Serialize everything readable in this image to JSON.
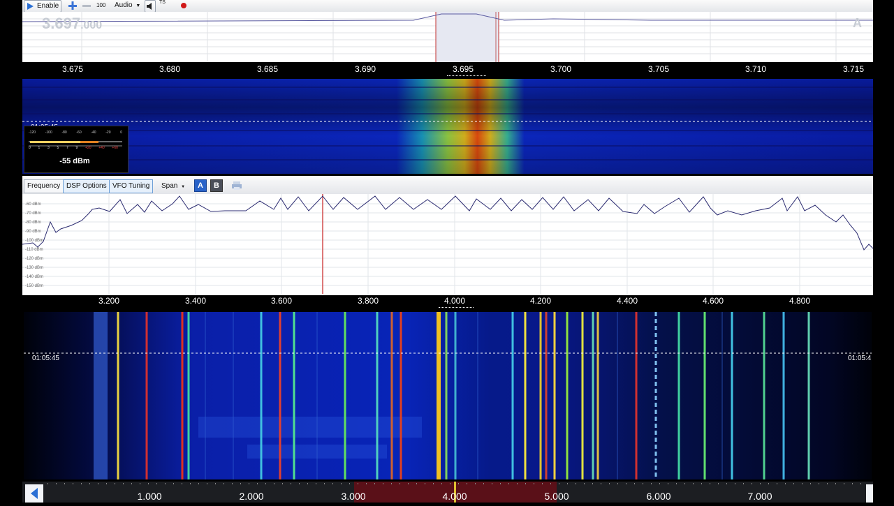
{
  "toolbar": {
    "enable_label": "Enable",
    "zoom_value": "100",
    "audio_label": "Audio",
    "ts_label": "TS"
  },
  "zoom_panel": {
    "frequency_readout": "3.697",
    "frequency_readout_suffix": ".000",
    "vfo_letter": "A",
    "scale_ticks": [
      "3.675",
      "3.680",
      "3.685",
      "3.690",
      "3.695",
      "3.700",
      "3.705",
      "3.710",
      "3.715"
    ],
    "waterfall_time": "01:05:45"
  },
  "smeter": {
    "top_scale": [
      "-120",
      "-100",
      "-80",
      "-60",
      "-40",
      "-20",
      "0"
    ],
    "bottom_scale": [
      "0",
      "1",
      "3",
      "5",
      "7",
      "9",
      "+20",
      "+40",
      "+60"
    ],
    "reading": "-55 dBm"
  },
  "panel_toolbar": {
    "tabs": [
      "Frequency",
      "DSP Options",
      "VFO Tuning"
    ],
    "span_label": "Span",
    "vfo_a": "A",
    "vfo_b": "B"
  },
  "main_spectrum": {
    "db_labels": [
      "-60 dBm",
      "-70 dBm",
      "-80 dBm",
      "-90 dBm",
      "-100 dBm",
      "-110 dBm",
      "-120 dBm",
      "-130 dBm",
      "-140 dBm",
      "-150 dBm"
    ],
    "scale_ticks": [
      "3.200",
      "3.400",
      "3.600",
      "3.800",
      "4.000",
      "4.200",
      "4.400",
      "4.600",
      "4.800"
    ],
    "waterfall_time_left": "01:05:45",
    "waterfall_time_right": "01:05:4"
  },
  "bottom_scale": {
    "ticks": [
      "1.000",
      "2.000",
      "3.000",
      "4.000",
      "5.000",
      "6.000",
      "7.000"
    ]
  },
  "colors": {
    "waterfall_base": "#0a1aa0",
    "accent": "#2d6fd0"
  }
}
